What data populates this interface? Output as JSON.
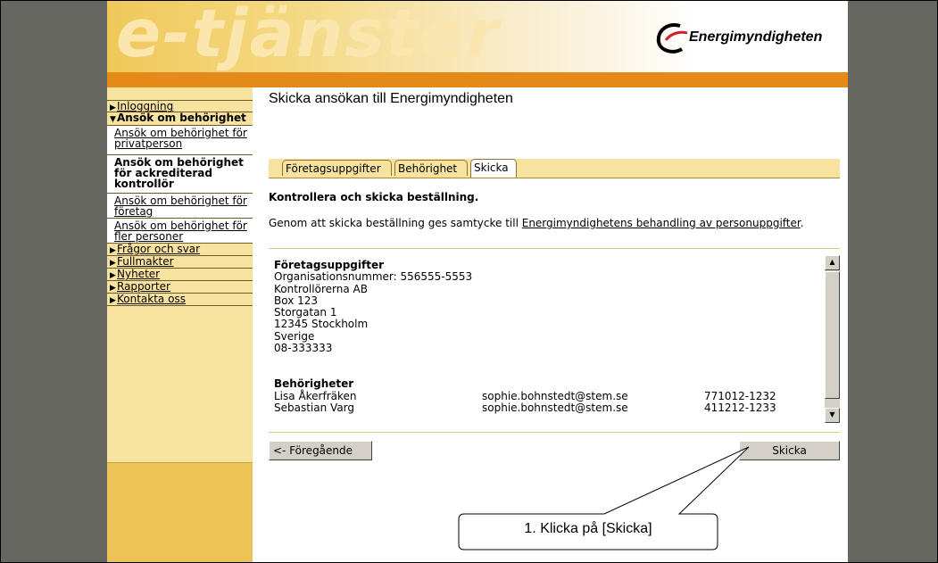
{
  "banner": {
    "wordmark": "e-tjänster",
    "logo_text": "Energimyndigheten"
  },
  "sidebar": {
    "items": [
      {
        "label": "Inloggning",
        "open": false
      },
      {
        "label": "Ansök om behörighet",
        "open": true,
        "children": [
          {
            "label": "Ansök om behörighet för privatperson",
            "active": false
          },
          {
            "label": "Ansök om behörighet för ackrediterad kontrollör",
            "active": true
          },
          {
            "label": "Ansök om behörighet för företag",
            "active": false
          },
          {
            "label": "Ansök om behörighet för fler personer",
            "active": false
          }
        ]
      },
      {
        "label": "Frågor och svar",
        "open": false
      },
      {
        "label": "Fullmakter",
        "open": false
      },
      {
        "label": "Nyheter",
        "open": false
      },
      {
        "label": "Rapporter",
        "open": false
      },
      {
        "label": "Kontakta oss",
        "open": false
      }
    ]
  },
  "main": {
    "title": "Skicka ansökan till Energimyndigheten",
    "tabs": [
      {
        "label": "Företagsuppgifter",
        "selected": false
      },
      {
        "label": "Behörighet",
        "selected": false
      },
      {
        "label": "Skicka",
        "selected": true
      }
    ],
    "heading": "Kontrollera och skicka beställning.",
    "consent_text": "Genom att skicka beställning ges samtycke till",
    "consent_link": "Energimyndighetens behandling av personuppgifter",
    "consent_end": ".",
    "company": {
      "heading": "Företagsuppgifter",
      "lines": [
        "Organisationsnummer: 556555-5553",
        "Kontrollörerna AB",
        "Box 123",
        "Storgatan 1",
        "12345 Stockholm",
        "Sverige",
        "08-333333"
      ]
    },
    "permissions": {
      "heading": "Behörigheter",
      "rows": [
        {
          "name": "Lisa Åkerfräken",
          "email": "sophie.bohnstedt@stem.se",
          "pnr": "771012-1232"
        },
        {
          "name": "Sebastian Varg",
          "email": "sophie.bohnstedt@stem.se",
          "pnr": "411212-1233"
        }
      ]
    },
    "prev_button": "<- Föregående",
    "send_button": "Skicka"
  },
  "annotation": {
    "text": "1. Klicka på [Skicka]"
  },
  "colors": {
    "banner_gold": "#f0c85a",
    "orange": "#e58918",
    "sidebar_bg": "#f7e39f",
    "frame_grey": "#676761"
  }
}
